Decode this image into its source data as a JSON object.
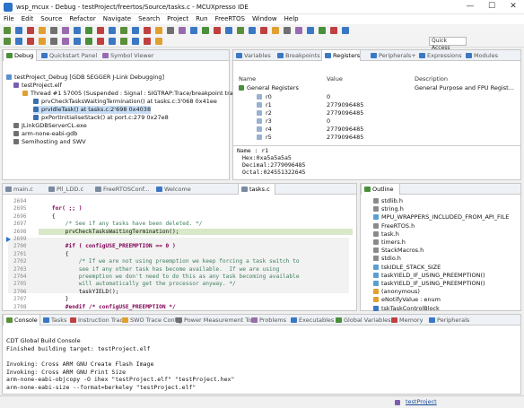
{
  "window": {
    "title": "wsp_mcux - Debug - testProject/freertos/Source/tasks.c - MCUXpresso IDE",
    "min": "—",
    "max": "☐",
    "close": "✕"
  },
  "menu": [
    "File",
    "Edit",
    "Source",
    "Refactor",
    "Navigate",
    "Search",
    "Project",
    "Run",
    "FreeRTOS",
    "Window",
    "Help"
  ],
  "quick_access": "Quick Access",
  "debug_panel": {
    "tabs": [
      "Debug",
      "Quickstart Panel",
      "Symbol Viewer"
    ],
    "tree": [
      "testProject_Debug [GDB SEGGER J-Link Debugging]",
      "testProject.elf",
      "Thread #1 57005 (Suspended : Signal : SIGTRAP:Trace/breakpoint trap)",
      "prvCheckTasksWaitingTermination() at tasks.c:3'068 0x41ee",
      "prvIdleTask() at tasks.c:2'698 0x4038",
      "pxPortInitialiseStack() at port.c:279 0x27e8",
      "JLinkGDBServerCL.exe",
      "arm-none-eabi-gdb",
      "Semihosting and SWV"
    ]
  },
  "registers_panel": {
    "tabs": [
      "Variables",
      "Breakpoints",
      "Registers",
      "Peripherals+",
      "Expressions",
      "Modules"
    ],
    "headers": [
      "Name",
      "Value",
      "Description"
    ],
    "group": {
      "name": "General Registers",
      "desc": "General Purpose and FPU Regist..."
    },
    "rows": [
      {
        "name": "r0",
        "value": "0"
      },
      {
        "name": "r1",
        "value": "2779096485"
      },
      {
        "name": "r2",
        "value": "2779096485"
      },
      {
        "name": "r3",
        "value": "0"
      },
      {
        "name": "r4",
        "value": "2779096485"
      },
      {
        "name": "r5",
        "value": "2779096485"
      }
    ],
    "detail": [
      "Name : r1",
      "Hex:0xa5a5a5a5",
      "Decimal:2779096485",
      "Octal:024551322645"
    ]
  },
  "editor": {
    "tabs": [
      "main.c",
      "Pll_LDD.c",
      "FreeRTOSConf...",
      "Welcome",
      "tasks.c"
    ],
    "lines": [
      {
        "n": "2694",
        "t": ""
      },
      {
        "n": "2695",
        "t": "    for( ;; )"
      },
      {
        "n": "2696",
        "t": "    {"
      },
      {
        "n": "2697",
        "t": "        /* See if any tasks have been deleted. */"
      },
      {
        "n": "2698",
        "t": "        prvCheckTasksWaitingTermination();"
      },
      {
        "n": "2699",
        "t": ""
      },
      {
        "n": "2700",
        "t": "        #if ( configUSE_PREEMPTION == 0 )"
      },
      {
        "n": "2701",
        "t": "        {"
      },
      {
        "n": "2702",
        "t": "            /* If we are not using preemption we keep forcing a task switch to"
      },
      {
        "n": "2703",
        "t": "            see if any other task has become available.  If we are using"
      },
      {
        "n": "2704",
        "t": "            preemption we don't need to do this as any task becoming available"
      },
      {
        "n": "2705",
        "t": "            will automatically get the processor anyway. */"
      },
      {
        "n": "2706",
        "t": "            taskYIELD();"
      },
      {
        "n": "2707",
        "t": "        }"
      },
      {
        "n": "2708",
        "t": "        #endif /* configUSE_PREEMPTION */"
      }
    ]
  },
  "outline": {
    "tab": "Outline",
    "items": [
      "stdlib.h",
      "string.h",
      "MPU_WRAPPERS_INCLUDED_FROM_API_FILE",
      "FreeRTOS.h",
      "task.h",
      "timers.h",
      "StackMacros.h",
      "stdio.h",
      "tskIDLE_STACK_SIZE",
      "taskYIELD_IF_USING_PREEMPTION()",
      "taskYIELD_IF_USING_PREEMPTION()",
      "(anonymous)",
      "eNotifyValue : enum",
      "tskTaskControlBlock"
    ]
  },
  "console": {
    "tabs": [
      "Console",
      "Tasks",
      "Instruction Trace",
      "SWO Trace Config",
      "Power Measurement Tool",
      "Problems",
      "Executables",
      "Global Variables",
      "Memory",
      "Peripherals"
    ],
    "title": "CDT Global Build Console",
    "lines": [
      "Finished building target: testProject.elf",
      "",
      "Invoking: Cross ARM GNU Create Flash Image",
      "Invoking: Cross ARM GNU Print Size",
      "arm-none-eabi-objcopy -O ihex \"testProject.elf\"  \"testProject.hex\"",
      "arm-none-eabi-size --format=berkeley \"testProject.elf\""
    ]
  },
  "status": {
    "project": "testProject"
  },
  "colors": {
    "accent": "#2a73c9",
    "selection": "#c9dff7",
    "current_line": "#d8e8c8"
  }
}
